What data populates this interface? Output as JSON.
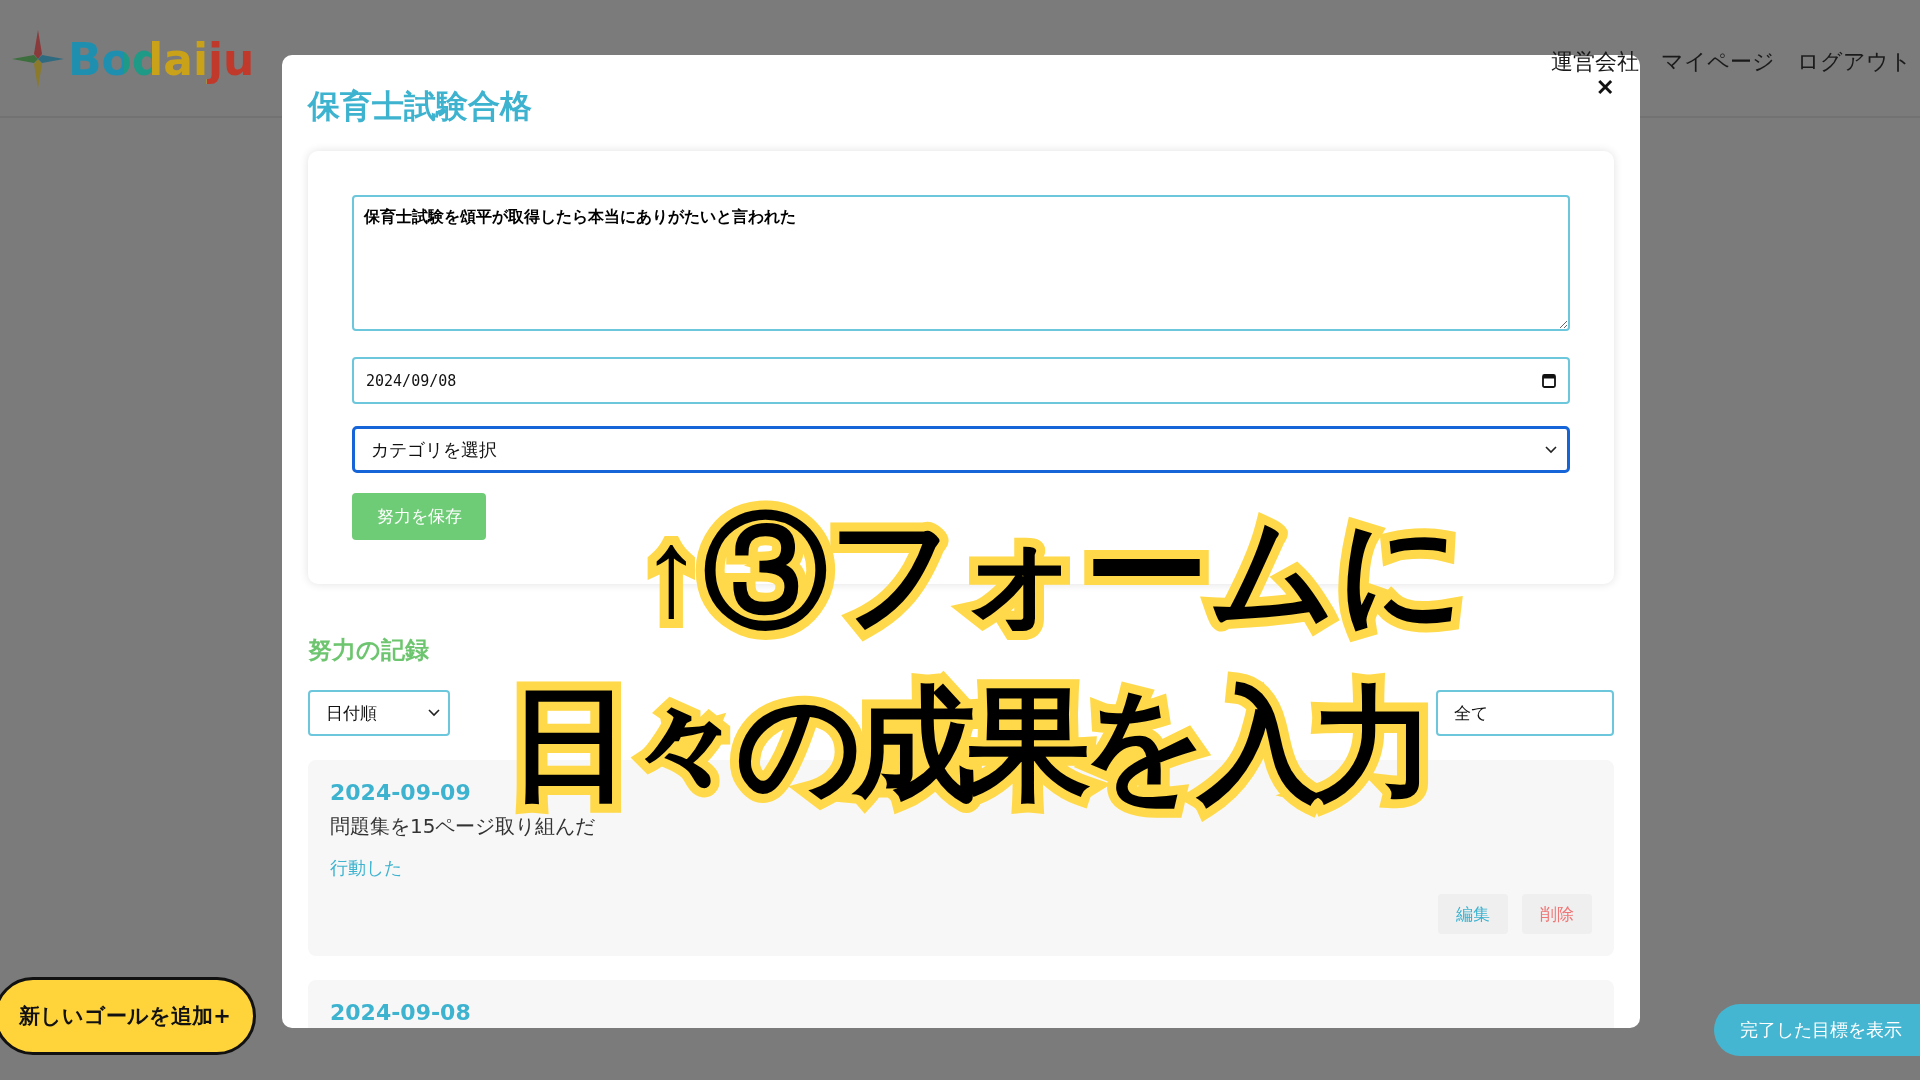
{
  "header": {
    "logo": "Bodaiju",
    "nav": [
      "運営会社",
      "マイページ",
      "ログアウト"
    ]
  },
  "modal": {
    "title": "保育士試験合格",
    "close": "✕",
    "form": {
      "note": "保育士試験を頌平が取得したら本当にありがたいと言われた",
      "date": "2024/09/08",
      "category": "カテゴリを選択",
      "save_button": "努力を保存"
    },
    "records_heading": "努力の記録",
    "sort": "日付順",
    "filter": "全て",
    "records": [
      {
        "date": "2024-09-09",
        "text": "問題集を15ページ取り組んだ",
        "tag": "行動した",
        "edit": "編集",
        "delete": "削除"
      },
      {
        "date": "2024-09-08"
      }
    ]
  },
  "add_goal_button": "新しいゴールを追加+",
  "show_completed_button": "完了した目標を表示",
  "annotation": [
    "↑③フォームに",
    "日々の成果を入力"
  ]
}
